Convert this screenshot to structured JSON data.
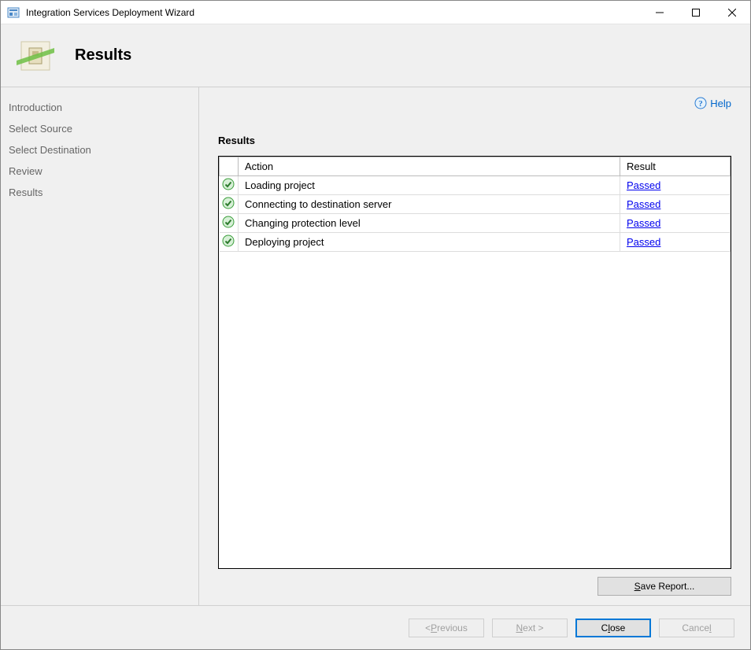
{
  "window": {
    "title": "Integration Services Deployment Wizard"
  },
  "header": {
    "title": "Results"
  },
  "sidebar": {
    "items": [
      {
        "label": "Introduction"
      },
      {
        "label": "Select Source"
      },
      {
        "label": "Select Destination"
      },
      {
        "label": "Review"
      },
      {
        "label": "Results"
      }
    ]
  },
  "content": {
    "help_label": "Help",
    "section_title": "Results",
    "columns": {
      "action": "Action",
      "result": "Result"
    },
    "rows": [
      {
        "action": "Loading project",
        "result": "Passed"
      },
      {
        "action": "Connecting to destination server",
        "result": "Passed"
      },
      {
        "action": "Changing protection level",
        "result": "Passed"
      },
      {
        "action": "Deploying project",
        "result": "Passed"
      }
    ],
    "save_report_label": "Save Report..."
  },
  "footer": {
    "previous": "< Previous",
    "next": "Next >",
    "close": "Close",
    "cancel": "Cancel"
  }
}
